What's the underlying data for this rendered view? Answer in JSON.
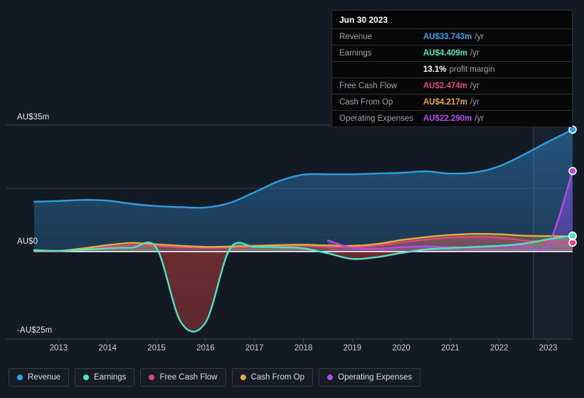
{
  "chart_data": {
    "type": "area",
    "title": "",
    "xlabel": "",
    "ylabel": "AU$",
    "currency": "AU$",
    "unit": "m",
    "x": [
      2012.5,
      2013,
      2013.5,
      2014,
      2014.5,
      2015,
      2015.5,
      2016,
      2016.5,
      2017,
      2017.5,
      2018,
      2018.5,
      2019,
      2019.5,
      2020,
      2020.5,
      2021,
      2021.5,
      2022,
      2022.5,
      2023,
      2023.5
    ],
    "xtick_labels": [
      "2013",
      "2014",
      "2015",
      "2016",
      "2017",
      "2018",
      "2019",
      "2020",
      "2021",
      "2022",
      "2023"
    ],
    "ylim": [
      -25,
      35
    ],
    "ytick_values": [
      35,
      17.5,
      0,
      -25
    ],
    "ytick_labels": [
      "AU$35m",
      "",
      "AU$0",
      "-AU$25m"
    ],
    "grid": true,
    "legend_position": "bottom",
    "zero_line": 0,
    "forecast_divider_x": 2022.7,
    "series": [
      {
        "name": "Revenue",
        "color": "#2d9fe0",
        "values": [
          13.8,
          14.0,
          14.3,
          14.1,
          13.2,
          12.6,
          12.3,
          12.2,
          13.5,
          16.4,
          19.5,
          21.3,
          21.4,
          21.4,
          21.6,
          21.8,
          22.2,
          21.6,
          21.9,
          23.6,
          26.8,
          30.4,
          33.743
        ],
        "end_value": 33.743,
        "end_label": "AU$33.743m /yr"
      },
      {
        "name": "Earnings",
        "color": "#4fe3c1",
        "values": [
          0.4,
          0.2,
          0.5,
          0.9,
          1.1,
          1.0,
          -20.2,
          -20.3,
          0.8,
          1.3,
          1.2,
          0.9,
          -0.5,
          -2.1,
          -1.6,
          -0.4,
          0.6,
          1.0,
          1.3,
          1.6,
          2.2,
          3.4,
          4.409
        ],
        "end_value": 4.409,
        "end_label": "AU$4.409m /yr"
      },
      {
        "name": "Free Cash Flow",
        "color": "#e0457b",
        "values": [
          0.2,
          0.1,
          0.6,
          1.3,
          1.7,
          1.5,
          1.2,
          1.0,
          1.1,
          1.3,
          1.5,
          1.6,
          1.3,
          1.2,
          1.6,
          2.6,
          3.3,
          3.9,
          4.1,
          3.9,
          3.1,
          2.7,
          2.474
        ],
        "end_value": 2.474,
        "end_label": "AU$2.474m /yr"
      },
      {
        "name": "Cash From Op",
        "color": "#e8a93f",
        "values": [
          0.3,
          0.2,
          0.9,
          1.8,
          2.4,
          2.0,
          1.6,
          1.3,
          1.4,
          1.6,
          1.8,
          1.9,
          1.7,
          1.6,
          2.1,
          3.2,
          4.0,
          4.6,
          4.9,
          4.8,
          4.4,
          4.3,
          4.217
        ],
        "end_value": 4.217,
        "end_label": "AU$4.217m /yr"
      },
      {
        "name": "Operating Expenses",
        "color": "#b44ce8",
        "values": [
          null,
          null,
          null,
          null,
          null,
          null,
          null,
          null,
          null,
          null,
          null,
          null,
          3.1,
          1.0,
          0.8,
          1.2,
          1.4,
          1.2,
          1.1,
          1.5,
          1.6,
          2.0,
          22.29
        ],
        "end_value": 22.29,
        "end_label": "AU$22.290m /yr"
      }
    ]
  },
  "tooltip": {
    "name": "chart-tooltip",
    "date": "Jun 30 2023",
    "rows": [
      {
        "label": "Revenue",
        "value": "AU$33.743m",
        "unit": "/yr",
        "color": "#3aa0e8"
      },
      {
        "label": "Earnings",
        "value": "AU$4.409m",
        "unit": "/yr",
        "color": "#4fe3c1"
      },
      {
        "label": "",
        "value": "13.1%",
        "unit": "profit margin",
        "color": "#ffffff"
      },
      {
        "label": "Free Cash Flow",
        "value": "AU$2.474m",
        "unit": "/yr",
        "color": "#e0457b"
      },
      {
        "label": "Cash From Op",
        "value": "AU$4.217m",
        "unit": "/yr",
        "color": "#e8a93f"
      },
      {
        "label": "Operating Expenses",
        "value": "AU$22.290m",
        "unit": "/yr",
        "color": "#b44ce8"
      }
    ]
  },
  "legend": {
    "items": [
      {
        "label": "Revenue",
        "color": "#3aa0e8"
      },
      {
        "label": "Earnings",
        "color": "#4fe3c1"
      },
      {
        "label": "Free Cash Flow",
        "color": "#e0457b"
      },
      {
        "label": "Cash From Op",
        "color": "#e8a93f"
      },
      {
        "label": "Operating Expenses",
        "color": "#b44ce8"
      }
    ]
  },
  "axis": {
    "y_top_label": "AU$35m",
    "y_zero_label": "AU$0",
    "y_bottom_label": "-AU$25m"
  }
}
